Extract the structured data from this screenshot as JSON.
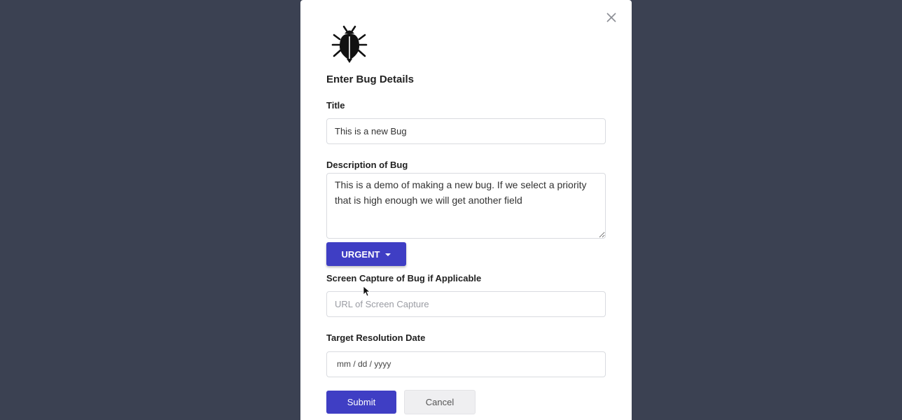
{
  "form": {
    "heading": "Enter Bug Details",
    "title_label": "Title",
    "title_value": "This is a new Bug",
    "description_label": "Description of Bug",
    "description_value": "This is a demo of making a new bug. If we select a priority that is high enough we will get another field",
    "priority_value": "URGENT",
    "screen_capture_label": "Screen Capture of Bug if Applicable",
    "screen_capture_placeholder": "URL of Screen Capture",
    "target_date_label": "Target Resolution Date",
    "target_date_placeholder": "mm / dd / yyyy"
  },
  "buttons": {
    "submit_label": "Submit",
    "cancel_label": "Cancel"
  },
  "icons": {
    "logo": "bug-icon",
    "close": "close-icon",
    "priority_caret": "caret-down-icon"
  },
  "colors": {
    "backdrop": "#3b4152",
    "primary": "#3f3ec4",
    "cancel_bg": "#efeff1"
  }
}
